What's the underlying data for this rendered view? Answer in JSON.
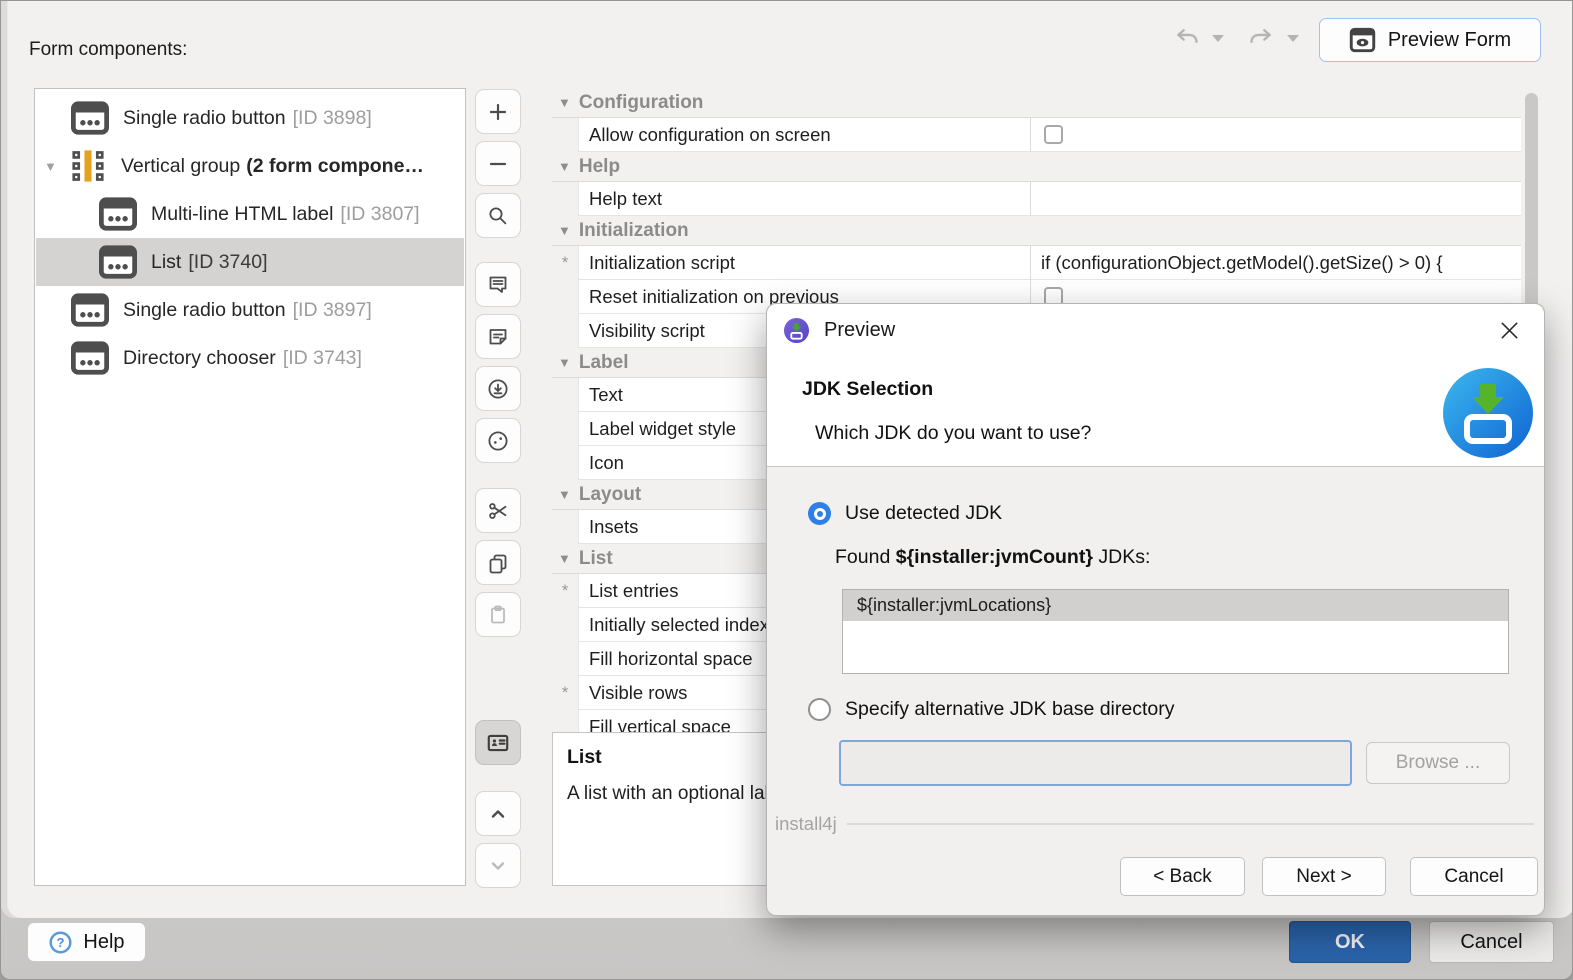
{
  "window": {
    "form_components_label": "Form components:"
  },
  "topbar": {
    "preview_form": "Preview Form",
    "icons": [
      "undo-icon",
      "undo-dropdown-icon",
      "redo-icon",
      "redo-dropdown-icon",
      "preview-eye-icon"
    ]
  },
  "tree": {
    "items": [
      {
        "icon": "form-component-icon",
        "label": "Single radio button",
        "id": "[ID 3898]"
      },
      {
        "icon": "vertical-group-icon",
        "label": "Vertical group ",
        "bold": "(2 form compone…"
      },
      {
        "icon": "form-component-icon",
        "label": "Multi-line HTML label",
        "id": "[ID 3807]"
      },
      {
        "icon": "form-component-icon",
        "label": "List",
        "id": "[ID 3740]"
      },
      {
        "icon": "form-component-icon",
        "label": "Single radio button",
        "id": "[ID 3897]"
      },
      {
        "icon": "form-component-icon",
        "label": "Directory chooser",
        "id": "[ID 3743]"
      }
    ]
  },
  "toolbar": {
    "icons": [
      "add-icon",
      "remove-icon",
      "search-icon",
      "comment-icon",
      "note-icon",
      "download-circle-icon",
      "socket-icon",
      "cut-icon",
      "copy-icon",
      "paste-icon",
      "id-card-icon",
      "move-up-icon",
      "move-down-icon"
    ]
  },
  "props": {
    "configuration": "Configuration",
    "allow_configuration": "Allow configuration on screen",
    "help": "Help",
    "help_text": "Help text",
    "initialization": "Initialization",
    "initialization_script": "Initialization script",
    "initialization_script_value": "if (configurationObject.getModel().getSize() > 0) {",
    "reset_initialization": "Reset initialization on previous",
    "visibility_script": "Visibility script",
    "label": "Label",
    "text": "Text",
    "label_widget_style": "Label widget style",
    "icon": "Icon",
    "layout": "Layout",
    "insets": "Insets",
    "list": "List",
    "list_entries": "List entries",
    "initially_selected": "Initially selected index",
    "fill_horizontal": "Fill horizontal space",
    "visible_rows": "Visible rows",
    "partial_row": "Fill vertical space",
    "required_marker": "*"
  },
  "description": {
    "title": "List",
    "text": "A list with an optional label. The selected"
  },
  "dialog": {
    "title": "Preview",
    "heading": "JDK Selection",
    "subheading": "Which JDK do you want to use?",
    "radio_detected": "Use detected JDK",
    "found_prefix": "Found ",
    "found_variable": "${installer:jvmCount}",
    "found_suffix": " JDKs:",
    "list_selected_item": "${installer:jvmLocations}",
    "radio_alternative": "Specify alternative JDK base directory",
    "directory_value": "",
    "browse": "Browse ...",
    "brand": "install4j",
    "back": "< Back",
    "next": "Next >",
    "cancel": "Cancel"
  },
  "footer": {
    "help": "Help",
    "ok": "OK",
    "cancel": "Cancel"
  },
  "colors": {
    "accent_blue": "#2e80e8",
    "ok_blue": "#2b64ab",
    "selected_row": "#d5d3d1",
    "group_icon_yellow": "#e2a41f",
    "installer_icon_blue_top": "#38b4ec",
    "installer_icon_blue_bottom": "#1163d2",
    "installer_arrow_green": "#55b42c",
    "dialog_icon_purple": "#6b56d0"
  }
}
